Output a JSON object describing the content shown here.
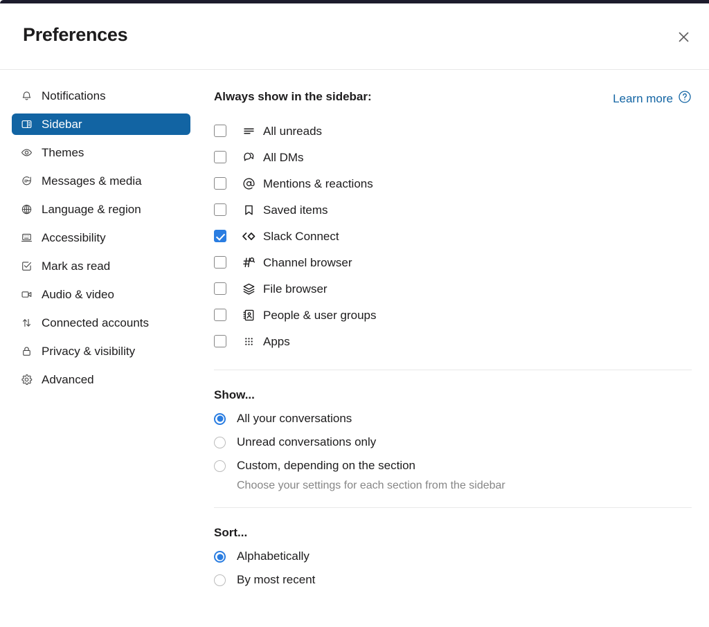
{
  "window": {
    "title": "Preferences",
    "close_icon": "close-icon"
  },
  "colors": {
    "selected_nav_bg": "#1264A3",
    "accent_blue": "#2A7DE1",
    "link_blue": "#1264A3",
    "text": "#1D1C1D",
    "muted_text": "#868686",
    "divider": "#E8E8E8",
    "titlebar": "#1D1C2D"
  },
  "sidebar": {
    "items": [
      {
        "label": "Notifications",
        "icon": "bell-icon",
        "selected": false
      },
      {
        "label": "Sidebar",
        "icon": "sidebar-panel-icon",
        "selected": true
      },
      {
        "label": "Themes",
        "icon": "eye-icon",
        "selected": false
      },
      {
        "label": "Messages & media",
        "icon": "message-bubble-icon",
        "selected": false
      },
      {
        "label": "Language & region",
        "icon": "globe-icon",
        "selected": false
      },
      {
        "label": "Accessibility",
        "icon": "keyboard-icon",
        "selected": false
      },
      {
        "label": "Mark as read",
        "icon": "check-square-icon",
        "selected": false
      },
      {
        "label": "Audio & video",
        "icon": "video-camera-icon",
        "selected": false
      },
      {
        "label": "Connected accounts",
        "icon": "arrows-updown-icon",
        "selected": false
      },
      {
        "label": "Privacy & visibility",
        "icon": "lock-icon",
        "selected": false
      },
      {
        "label": "Advanced",
        "icon": "gear-icon",
        "selected": false
      }
    ]
  },
  "main": {
    "always_show": {
      "title": "Always show in the sidebar:",
      "learn_more_label": "Learn more",
      "learn_more_icon": "question-circle-icon",
      "items": [
        {
          "label": "All unreads",
          "icon": "unreads-lines-icon",
          "checked": false
        },
        {
          "label": "All DMs",
          "icon": "dm-bubbles-icon",
          "checked": false
        },
        {
          "label": "Mentions & reactions",
          "icon": "at-sign-icon",
          "checked": false
        },
        {
          "label": "Saved items",
          "icon": "bookmark-icon",
          "checked": false
        },
        {
          "label": "Slack Connect",
          "icon": "slack-connect-icon",
          "checked": true
        },
        {
          "label": "Channel browser",
          "icon": "channel-search-icon",
          "checked": false
        },
        {
          "label": "File browser",
          "icon": "layers-icon",
          "checked": false
        },
        {
          "label": "People & user groups",
          "icon": "address-book-icon",
          "checked": false
        },
        {
          "label": "Apps",
          "icon": "apps-grid-icon",
          "checked": false
        }
      ]
    },
    "show_section": {
      "title": "Show...",
      "options": [
        {
          "label": "All your conversations",
          "description": "",
          "selected": true
        },
        {
          "label": "Unread conversations only",
          "description": "",
          "selected": false
        },
        {
          "label": "Custom, depending on the section",
          "description": "Choose your settings for each section from the sidebar",
          "selected": false
        }
      ]
    },
    "sort_section": {
      "title": "Sort...",
      "options": [
        {
          "label": "Alphabetically",
          "description": "",
          "selected": true
        },
        {
          "label": "By most recent",
          "description": "",
          "selected": false
        }
      ]
    }
  }
}
